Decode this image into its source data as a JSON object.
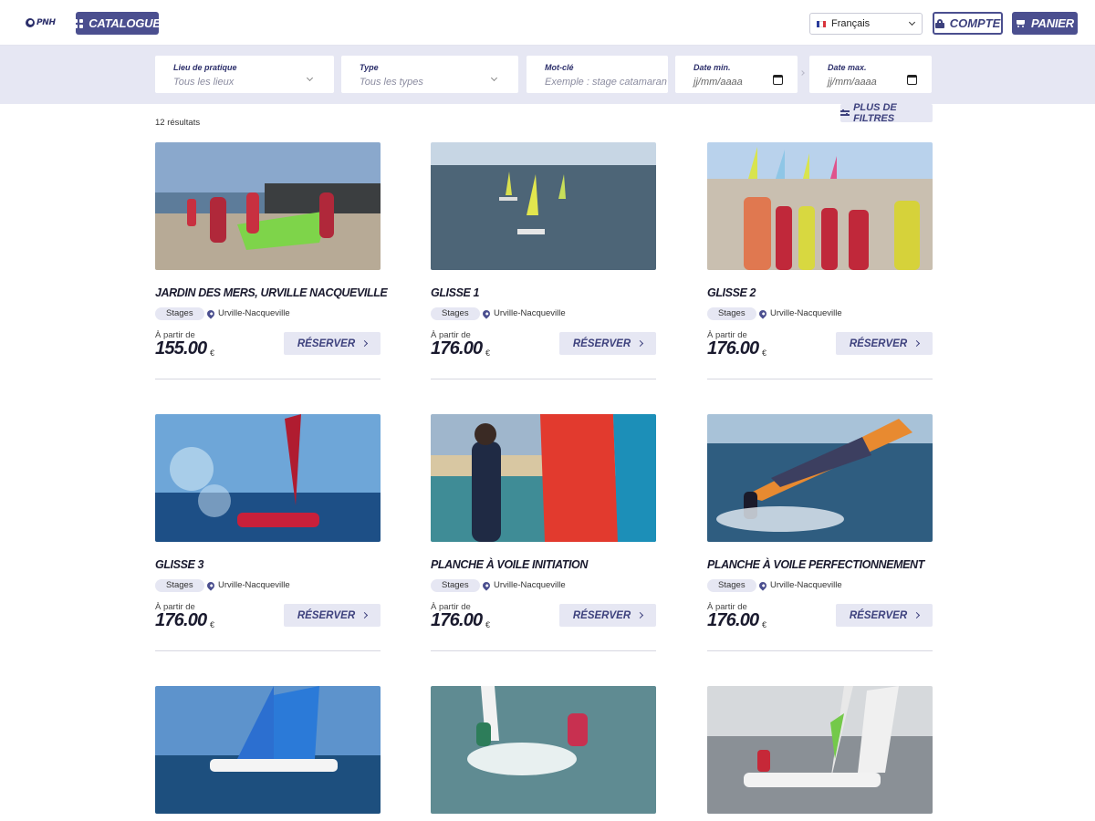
{
  "header": {
    "logo_text": "PNH",
    "catalogue_label": "Catalogue",
    "language": "Français",
    "account_label": "Compte",
    "cart_label": "Panier"
  },
  "filters": {
    "location": {
      "label": "Lieu de pratique",
      "value": "Tous les lieux"
    },
    "type": {
      "label": "Type",
      "value": "Tous les types"
    },
    "keyword": {
      "label": "Mot-clé",
      "placeholder": "Exemple : stage catamaran"
    },
    "date_min": {
      "label": "Date min.",
      "value": "jj/mm/aaaa"
    },
    "date_max": {
      "label": "Date max.",
      "value": "jj/mm/aaaa"
    }
  },
  "results": {
    "count_text": "12 résultats",
    "more_filters_label": "Plus de filtres"
  },
  "card_labels": {
    "from": "À partir de",
    "currency": "€",
    "reserve": "Réserver"
  },
  "cards": [
    {
      "title": "Jardin des mers, Urville Nacqueville",
      "category": "Stages",
      "location": "Urville-Nacqueville",
      "price": "155.00",
      "photo": "children-carrying-sail-beach"
    },
    {
      "title": "Glisse 1",
      "category": "Stages",
      "location": "Urville-Nacqueville",
      "price": "176.00",
      "photo": "small-catamarans-at-sea"
    },
    {
      "title": "Glisse 2",
      "category": "Stages",
      "location": "Urville-Nacqueville",
      "price": "176.00",
      "photo": "group-in-lifejackets-beach"
    },
    {
      "title": "Glisse 3",
      "category": "Stages",
      "location": "Urville-Nacqueville",
      "price": "176.00",
      "photo": "catamaran-splash"
    },
    {
      "title": "Planche à voile initiation",
      "category": "Stages",
      "location": "Urville-Nacqueville",
      "price": "176.00",
      "photo": "windsurf-beginner"
    },
    {
      "title": "Planche à voile perfectionnement",
      "category": "Stages",
      "location": "Urville-Nacqueville",
      "price": "176.00",
      "photo": "windsurf-advanced"
    },
    {
      "title": "",
      "category": "",
      "location": "",
      "price": "",
      "photo": "catamaran-blue-sail"
    },
    {
      "title": "",
      "category": "",
      "location": "",
      "price": "",
      "photo": "kids-dinghy"
    },
    {
      "title": "",
      "category": "",
      "location": "",
      "price": "",
      "photo": "catamaran-grey-sea"
    }
  ],
  "colors": {
    "primary": "#4b4f8f",
    "light": "#e6e7f3",
    "text": "#1a1a2e"
  }
}
